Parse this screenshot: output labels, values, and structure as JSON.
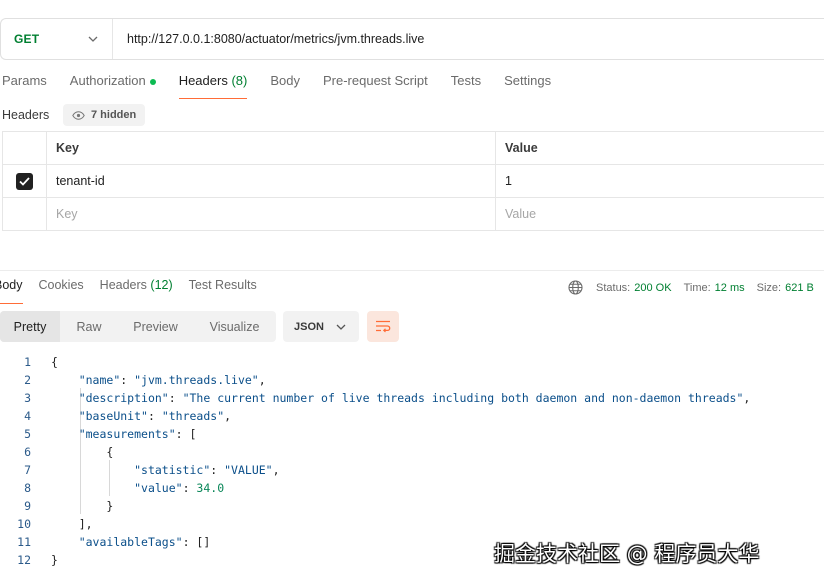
{
  "request": {
    "method": "GET",
    "url": "http://127.0.0.1:8080/actuator/metrics/jvm.threads.live"
  },
  "request_tabs": [
    {
      "label": "Params"
    },
    {
      "label": "Authorization"
    },
    {
      "label": "Headers",
      "count": "(8)"
    },
    {
      "label": "Body"
    },
    {
      "label": "Pre-request Script"
    },
    {
      "label": "Tests"
    },
    {
      "label": "Settings"
    }
  ],
  "headers_section": {
    "label": "Headers",
    "hidden_label": "7 hidden",
    "columns": {
      "key": "Key",
      "value": "Value"
    },
    "rows": [
      {
        "key": "tenant-id",
        "value": "1",
        "checked": true
      }
    ],
    "placeholder": {
      "key": "Key",
      "value": "Value"
    }
  },
  "response_tabs": [
    {
      "label": "Body"
    },
    {
      "label": "Cookies"
    },
    {
      "label": "Headers",
      "count": "(12)"
    },
    {
      "label": "Test Results"
    }
  ],
  "response_status": {
    "status_label": "Status:",
    "status_value": "200 OK",
    "time_label": "Time:",
    "time_value": "12 ms",
    "size_label": "Size:",
    "size_value": "621 B"
  },
  "view_modes": [
    "Pretty",
    "Raw",
    "Preview",
    "Visualize"
  ],
  "format_select": "JSON",
  "code_lines": [
    "{",
    "    \"name\": \"jvm.threads.live\",",
    "    \"description\": \"The current number of live threads including both daemon and non-daemon threads\",",
    "    \"baseUnit\": \"threads\",",
    "    \"measurements\": [",
    "        {",
    "            \"statistic\": \"VALUE\",",
    "            \"value\": 34.0",
    "        }",
    "    ],",
    "    \"availableTags\": []",
    "}"
  ],
  "line_numbers": [
    "1",
    "2",
    "3",
    "4",
    "5",
    "6",
    "7",
    "8",
    "9",
    "10",
    "11",
    "12"
  ],
  "watermark": "掘金技术社区 @ 程序员大华",
  "colors": {
    "accent": "#ff6c37",
    "method_get": "#007f31",
    "status_ok": "#007f31",
    "auth_dot": "#0cbb52"
  }
}
